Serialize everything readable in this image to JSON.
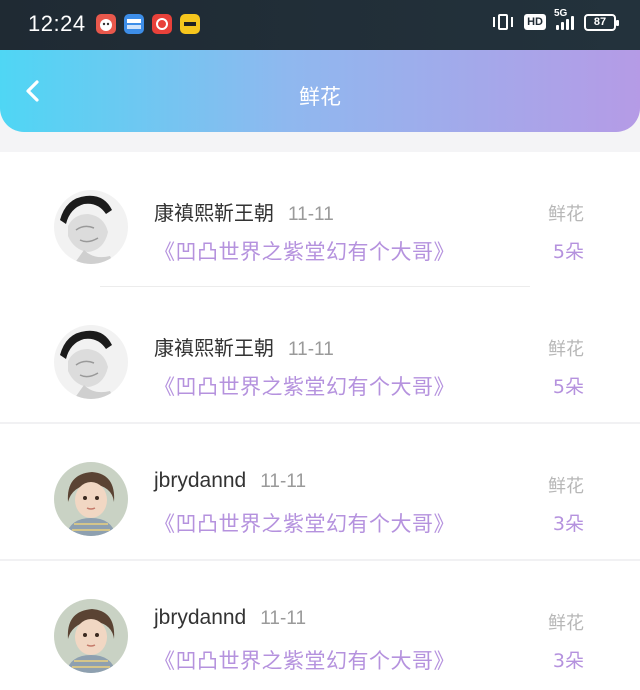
{
  "status_bar": {
    "time": "12:24",
    "app_icons": [
      {
        "name": "app-icon-cartoon",
        "label": "",
        "color": "#e8584c"
      },
      {
        "name": "app-icon-news",
        "label": "",
        "color": "#3d8ee8"
      },
      {
        "name": "app-icon-pinduoduo",
        "label": "",
        "color": "#e8413a"
      },
      {
        "name": "app-icon-meituan",
        "label": "",
        "color": "#f6c61d"
      }
    ],
    "hd": "HD",
    "network": "5G",
    "battery": "87"
  },
  "header": {
    "title": "鲜花",
    "back_icon": "chevron-left-icon",
    "gradient": [
      "#4fd6f4",
      "#8fb8ef",
      "#b59be6"
    ]
  },
  "records": [
    {
      "user": "康禛熙靳王朝",
      "date": "11-11",
      "book": "《凹凸世界之紫堂幻有个大哥》",
      "gift_type": "鲜花",
      "count": "5朵",
      "avatar": "sketch"
    },
    {
      "user": "康禛熙靳王朝",
      "date": "11-11",
      "book": "《凹凸世界之紫堂幻有个大哥》",
      "gift_type": "鲜花",
      "count": "5朵",
      "avatar": "sketch"
    },
    {
      "user": "jbrydannd",
      "date": "11-11",
      "book": "《凹凸世界之紫堂幻有个大哥》",
      "gift_type": "鲜花",
      "count": "3朵",
      "avatar": "girl"
    },
    {
      "user": "jbrydannd",
      "date": "11-11",
      "book": "《凹凸世界之紫堂幻有个大哥》",
      "gift_type": "鲜花",
      "count": "3朵",
      "avatar": "girl"
    }
  ],
  "colors": {
    "accent": "#b592de",
    "muted": "#b7b7b7",
    "name": "#333333"
  }
}
